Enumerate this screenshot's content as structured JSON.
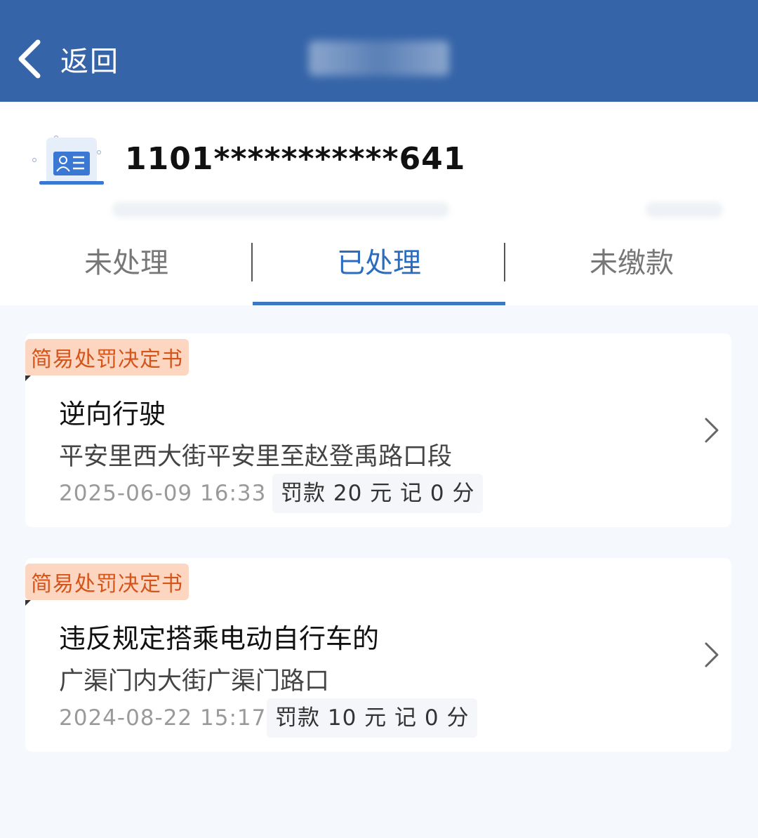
{
  "header": {
    "back_label": "返回",
    "colors": {
      "bar": "#3564a8"
    }
  },
  "account": {
    "id_number": "1101***********641",
    "icon": "id-card-icon"
  },
  "tabs": [
    {
      "label": "未处理",
      "active": false
    },
    {
      "label": "已处理",
      "active": true
    },
    {
      "label": "未缴款",
      "active": false
    }
  ],
  "records": [
    {
      "badge": "简易处罚决定书",
      "title": "逆向行驶",
      "location": "平安里西大街平安里至赵登禹路口段",
      "time": "2025-06-09 16:33",
      "penalty": "罚款 20 元  记 0 分"
    },
    {
      "badge": "简易处罚决定书",
      "title": "违反规定搭乘电动自行车的",
      "location": "广渠门内大街广渠门路口",
      "time": "2024-08-22 15:17",
      "penalty": "罚款 10 元  记 0 分"
    }
  ],
  "colors": {
    "accent": "#2a6cc0",
    "badge_bg": "#fcd6c0",
    "badge_text": "#d4541a"
  }
}
